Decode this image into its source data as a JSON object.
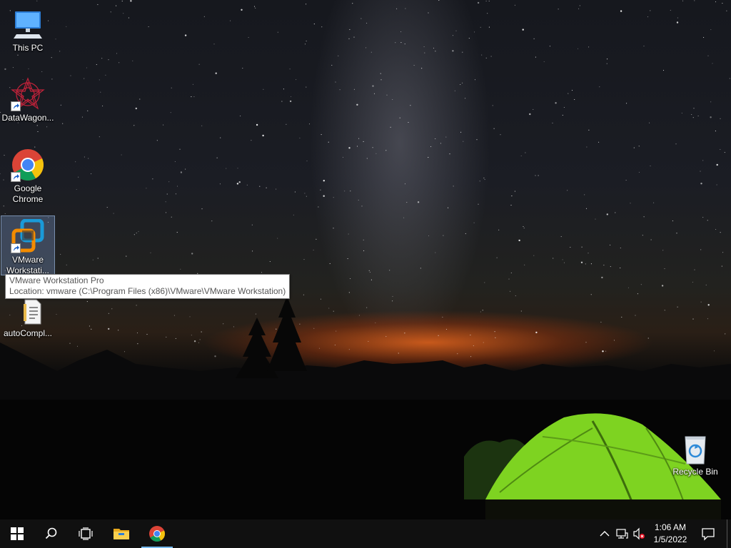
{
  "desktop": {
    "icons": [
      {
        "label": "This PC",
        "icon": "computer-icon",
        "shortcut": false
      },
      {
        "label": "DataWagon...",
        "icon": "datawagon-icon",
        "shortcut": true
      },
      {
        "label": "Google Chrome",
        "icon": "chrome-icon",
        "shortcut": true
      },
      {
        "label": "VMware Workstati...",
        "icon": "vmware-icon",
        "shortcut": true,
        "selected": true
      },
      {
        "label": "autoCompl...",
        "icon": "document-icon",
        "shortcut": false
      },
      {
        "label": "Recycle Bin",
        "icon": "recycle-bin-icon",
        "shortcut": false
      }
    ],
    "tooltip": {
      "line1": "VMware Workstation Pro",
      "line2": "Location: vmware (C:\\Program Files (x86)\\VMware\\VMware Workstation)"
    }
  },
  "taskbar": {
    "buttons": [
      {
        "name": "start",
        "icon": "windows-logo-icon"
      },
      {
        "name": "search",
        "icon": "search-icon"
      },
      {
        "name": "task-view",
        "icon": "task-view-icon"
      },
      {
        "name": "file-explorer",
        "icon": "folder-icon"
      },
      {
        "name": "chrome",
        "icon": "chrome-icon",
        "active": true
      }
    ],
    "tray": {
      "icons": [
        "chevron-up-icon",
        "network-icon",
        "volume-muted-icon"
      ],
      "time": "1:06 AM",
      "date": "1/5/2022"
    }
  },
  "colors": {
    "taskbar": "#101010",
    "active_indicator": "#76b9ed",
    "tent": "#7ed321"
  }
}
